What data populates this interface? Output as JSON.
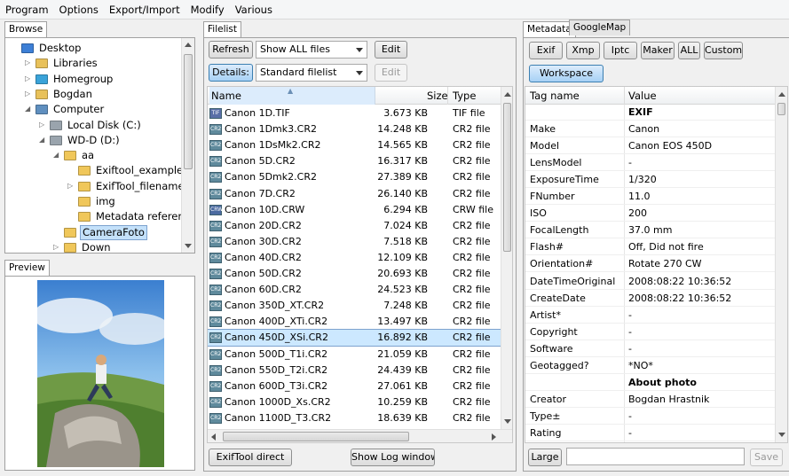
{
  "menu": [
    "Program",
    "Options",
    "Export/Import",
    "Modify",
    "Various"
  ],
  "browse": {
    "tab": "Browse",
    "tree": [
      {
        "label": "Desktop",
        "depth": 0,
        "icon": "desktop-icon",
        "exp": ""
      },
      {
        "label": "Libraries",
        "depth": 1,
        "icon": "libraries-icon",
        "exp": "▷"
      },
      {
        "label": "Homegroup",
        "depth": 1,
        "icon": "homegroup-icon",
        "exp": "▷"
      },
      {
        "label": "Bogdan",
        "depth": 1,
        "icon": "user-folder-icon",
        "exp": "▷"
      },
      {
        "label": "Computer",
        "depth": 1,
        "icon": "computer-icon",
        "exp": "◢"
      },
      {
        "label": "Local Disk (C:)",
        "depth": 2,
        "icon": "drive-icon",
        "exp": "▷"
      },
      {
        "label": "WD-D (D:)",
        "depth": 2,
        "icon": "drive-icon",
        "exp": "◢"
      },
      {
        "label": "aa",
        "depth": 3,
        "icon": "folder-icon",
        "exp": "◢"
      },
      {
        "label": "Exiftool_examples",
        "depth": 4,
        "icon": "folder-icon",
        "exp": ""
      },
      {
        "label": "ExifTool_filenames",
        "depth": 4,
        "icon": "folder-icon",
        "exp": "▷"
      },
      {
        "label": "img",
        "depth": 4,
        "icon": "folder-icon",
        "exp": ""
      },
      {
        "label": "Metadata reference",
        "depth": 4,
        "icon": "folder-icon",
        "exp": ""
      },
      {
        "label": "CameraFoto",
        "depth": 3,
        "icon": "folder-icon",
        "exp": "",
        "selected": true
      },
      {
        "label": "Down",
        "depth": 3,
        "icon": "folder-icon",
        "exp": "▷"
      }
    ]
  },
  "preview": {
    "tab": "Preview"
  },
  "filelist": {
    "tab": "Filelist",
    "refresh": "Refresh",
    "filter": "Show ALL files",
    "edit": "Edit",
    "details": "Details:",
    "view": "Standard filelist",
    "edit2": "Edit",
    "columns": {
      "name": "Name",
      "size": "Size",
      "type": "Type"
    },
    "files": [
      {
        "name": "Canon 1D.TIF",
        "size": "3.673 KB",
        "type": "TIF file",
        "ic": "TIF"
      },
      {
        "name": "Canon 1Dmk3.CR2",
        "size": "14.248 KB",
        "type": "CR2 file",
        "ic": "CR2"
      },
      {
        "name": "Canon 1DsMk2.CR2",
        "size": "14.565 KB",
        "type": "CR2 file",
        "ic": "CR2"
      },
      {
        "name": "Canon 5D.CR2",
        "size": "16.317 KB",
        "type": "CR2 file",
        "ic": "CR2"
      },
      {
        "name": "Canon 5Dmk2.CR2",
        "size": "27.389 KB",
        "type": "CR2 file",
        "ic": "CR2"
      },
      {
        "name": "Canon 7D.CR2",
        "size": "26.140 KB",
        "type": "CR2 file",
        "ic": "CR2"
      },
      {
        "name": "Canon 10D.CRW",
        "size": "6.294 KB",
        "type": "CRW file",
        "ic": "CRW"
      },
      {
        "name": "Canon 20D.CR2",
        "size": "7.024 KB",
        "type": "CR2 file",
        "ic": "CR2"
      },
      {
        "name": "Canon 30D.CR2",
        "size": "7.518 KB",
        "type": "CR2 file",
        "ic": "CR2"
      },
      {
        "name": "Canon 40D.CR2",
        "size": "12.109 KB",
        "type": "CR2 file",
        "ic": "CR2"
      },
      {
        "name": "Canon 50D.CR2",
        "size": "20.693 KB",
        "type": "CR2 file",
        "ic": "CR2"
      },
      {
        "name": "Canon 60D.CR2",
        "size": "24.523 KB",
        "type": "CR2 file",
        "ic": "CR2"
      },
      {
        "name": "Canon 350D_XT.CR2",
        "size": "7.248 KB",
        "type": "CR2 file",
        "ic": "CR2"
      },
      {
        "name": "Canon 400D_XTi.CR2",
        "size": "13.497 KB",
        "type": "CR2 file",
        "ic": "CR2"
      },
      {
        "name": "Canon 450D_XSi.CR2",
        "size": "16.892 KB",
        "type": "CR2 file",
        "ic": "CR2",
        "selected": true
      },
      {
        "name": "Canon 500D_T1i.CR2",
        "size": "21.059 KB",
        "type": "CR2 file",
        "ic": "CR2"
      },
      {
        "name": "Canon 550D_T2i.CR2",
        "size": "24.439 KB",
        "type": "CR2 file",
        "ic": "CR2"
      },
      {
        "name": "Canon 600D_T3i.CR2",
        "size": "27.061 KB",
        "type": "CR2 file",
        "ic": "CR2"
      },
      {
        "name": "Canon 1000D_Xs.CR2",
        "size": "10.259 KB",
        "type": "CR2 file",
        "ic": "CR2"
      },
      {
        "name": "Canon 1100D_T3.CR2",
        "size": "18.639 KB",
        "type": "CR2 file",
        "ic": "CR2"
      }
    ],
    "exiftool_direct": "ExifTool direct",
    "show_log": "Show Log window"
  },
  "metadata": {
    "tabs": [
      "Metadata",
      "GoogleMap"
    ],
    "buttons": [
      "Exif",
      "Xmp",
      "Iptc",
      "Maker",
      "ALL",
      "Custom"
    ],
    "workspace": "Workspace",
    "columns": {
      "tag": "Tag name",
      "value": "Value"
    },
    "rows": [
      {
        "tag": "",
        "value": "EXIF",
        "section": true
      },
      {
        "tag": "Make",
        "value": "Canon"
      },
      {
        "tag": "Model",
        "value": "Canon EOS 450D"
      },
      {
        "tag": "LensModel",
        "value": "-"
      },
      {
        "tag": "ExposureTime",
        "value": "1/320"
      },
      {
        "tag": "FNumber",
        "value": "11.0"
      },
      {
        "tag": "ISO",
        "value": "200"
      },
      {
        "tag": "FocalLength",
        "value": "37.0 mm"
      },
      {
        "tag": "Flash#",
        "value": "Off, Did not fire"
      },
      {
        "tag": "Orientation#",
        "value": "Rotate 270 CW"
      },
      {
        "tag": "DateTimeOriginal",
        "value": "2008:08:22 10:36:52"
      },
      {
        "tag": "CreateDate",
        "value": "2008:08:22 10:36:52"
      },
      {
        "tag": "Artist*",
        "value": "-"
      },
      {
        "tag": "Copyright",
        "value": "-"
      },
      {
        "tag": "Software",
        "value": "-"
      },
      {
        "tag": "Geotagged?",
        "value": "*NO*"
      },
      {
        "tag": "",
        "value": "About photo",
        "section": true
      },
      {
        "tag": "Creator",
        "value": "Bogdan Hrastnik"
      },
      {
        "tag": "Type±",
        "value": "-"
      },
      {
        "tag": "Rating",
        "value": "-"
      }
    ],
    "large": "Large",
    "save": "Save",
    "edit_value": ""
  },
  "colors": {
    "selection": "#cce8ff",
    "selection_border": "#7da2ce",
    "tree_selected": "#c4e1fa"
  }
}
